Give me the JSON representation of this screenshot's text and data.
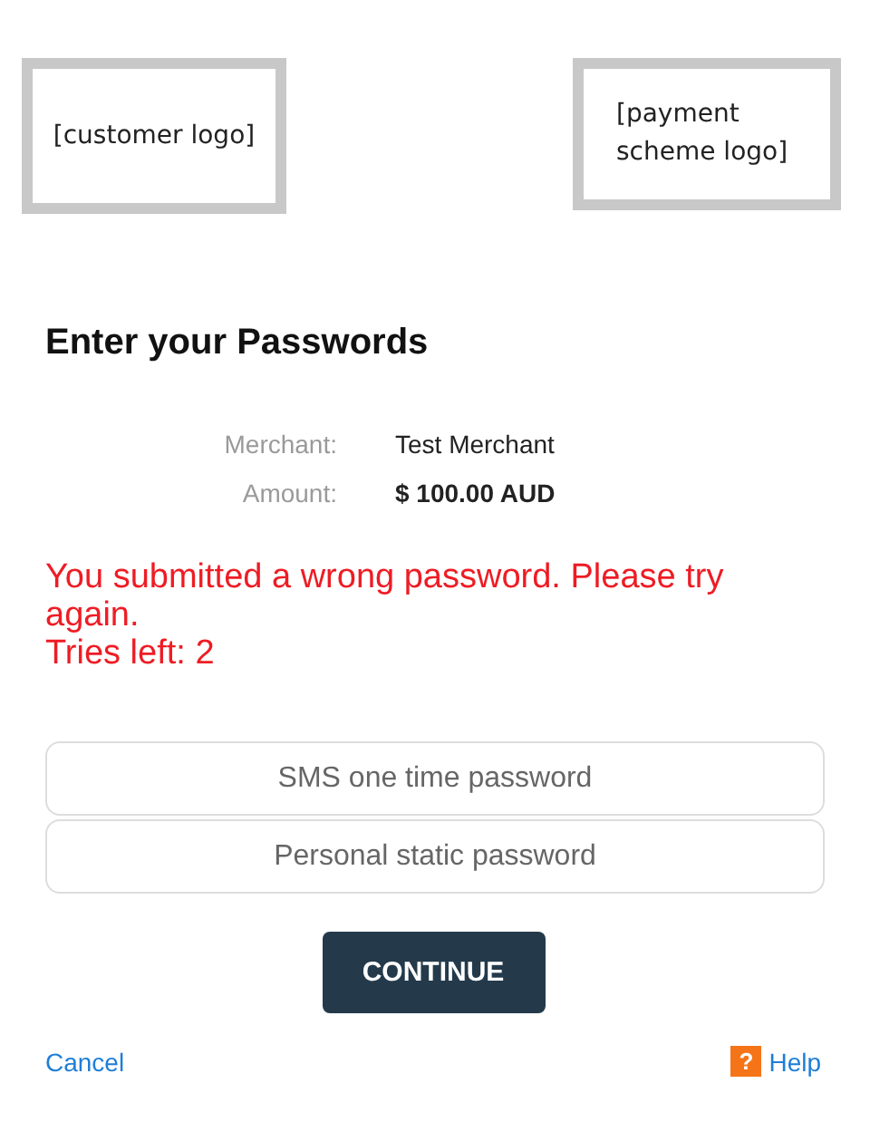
{
  "logos": [
    {
      "text": "[customer logo]"
    },
    {
      "text": "[payment scheme logo]"
    }
  ],
  "title": "Enter your Passwords",
  "details": [
    {
      "label": "Merchant:",
      "value": "Test Merchant",
      "bold": false
    },
    {
      "label": "Amount:",
      "value": "$ 100.00 AUD",
      "bold": true
    }
  ],
  "error": {
    "message": "You submitted a wrong password. Please try again.",
    "tries": "Tries left: 2"
  },
  "fields": [
    {
      "placeholder": "SMS one time password"
    },
    {
      "placeholder": "Personal static password"
    }
  ],
  "button": "CONTINUE",
  "cancel": "Cancel",
  "help": {
    "icon": "?",
    "label": "Help"
  }
}
